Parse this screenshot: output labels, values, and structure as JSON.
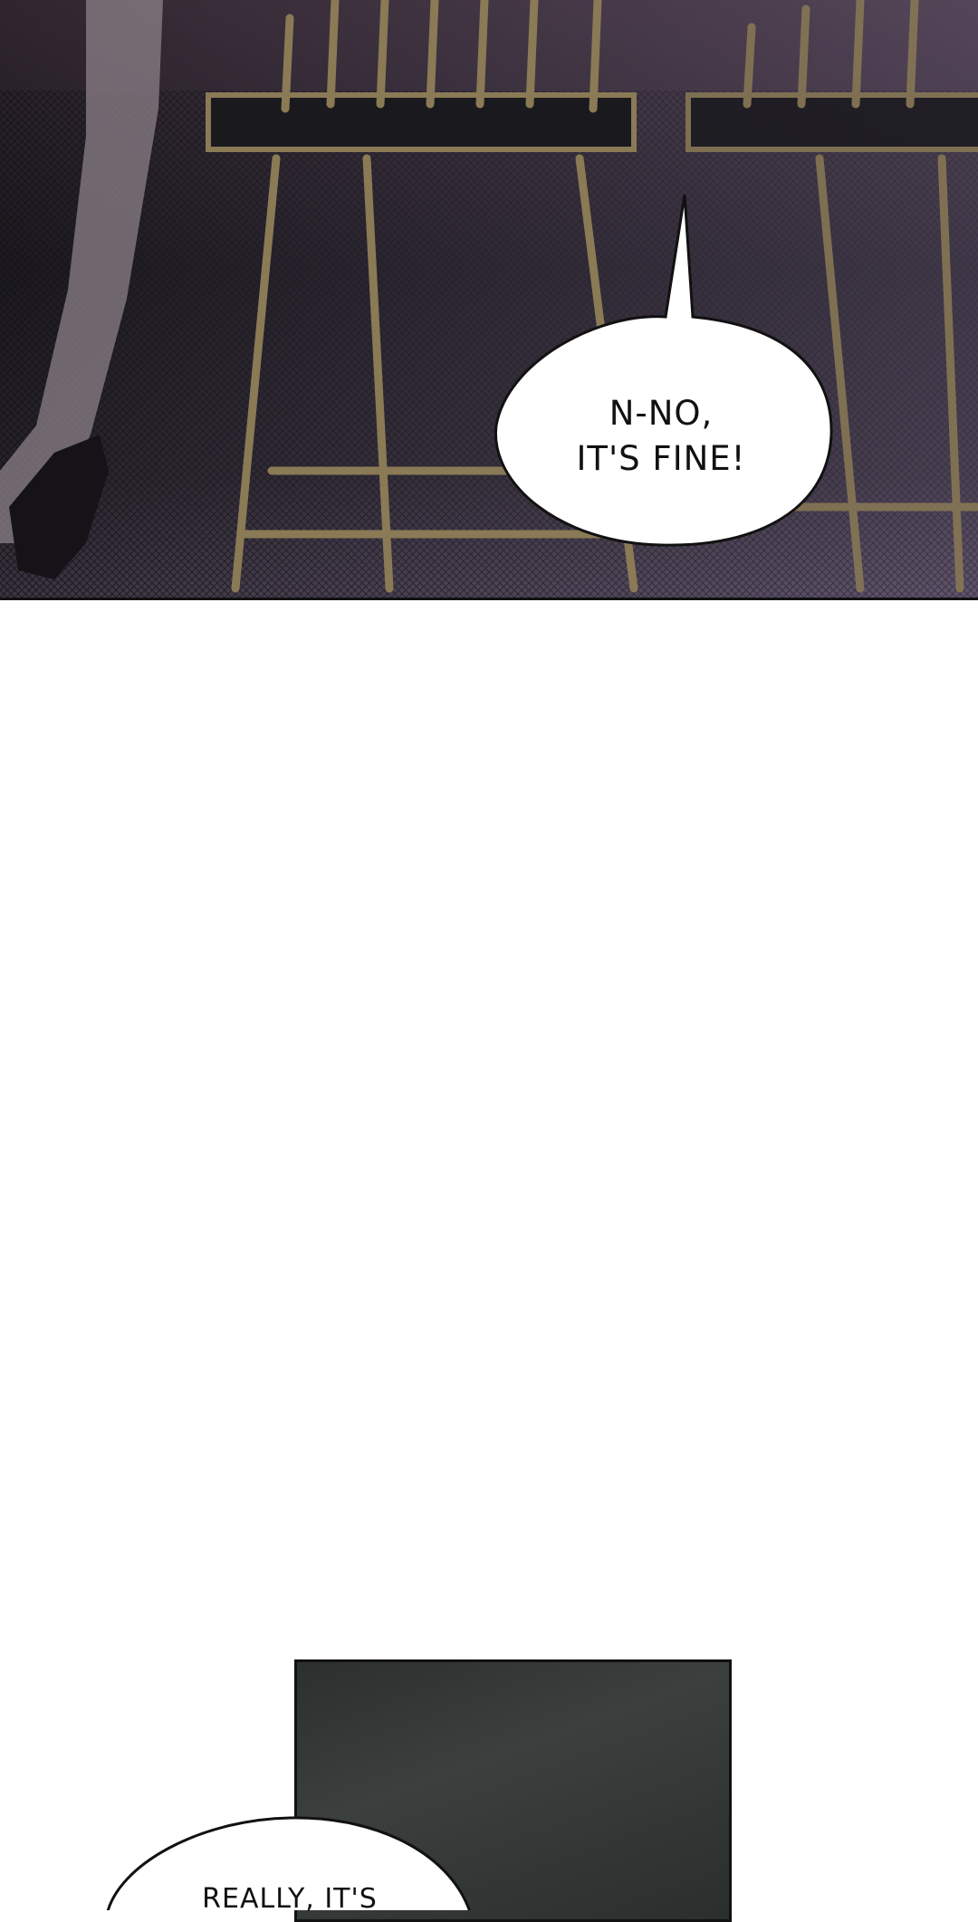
{
  "panels": [
    {
      "speech_bubble": {
        "text": "N-NO,\nIT'S FINE!"
      }
    },
    {
      "speech_bubble": {
        "text": "REALLY, IT'S"
      }
    }
  ],
  "colors": {
    "page_background": "#ffffff",
    "bubble_fill": "#ffffff",
    "bubble_outline": "#111111",
    "chair_frame": "#8a7a55"
  }
}
